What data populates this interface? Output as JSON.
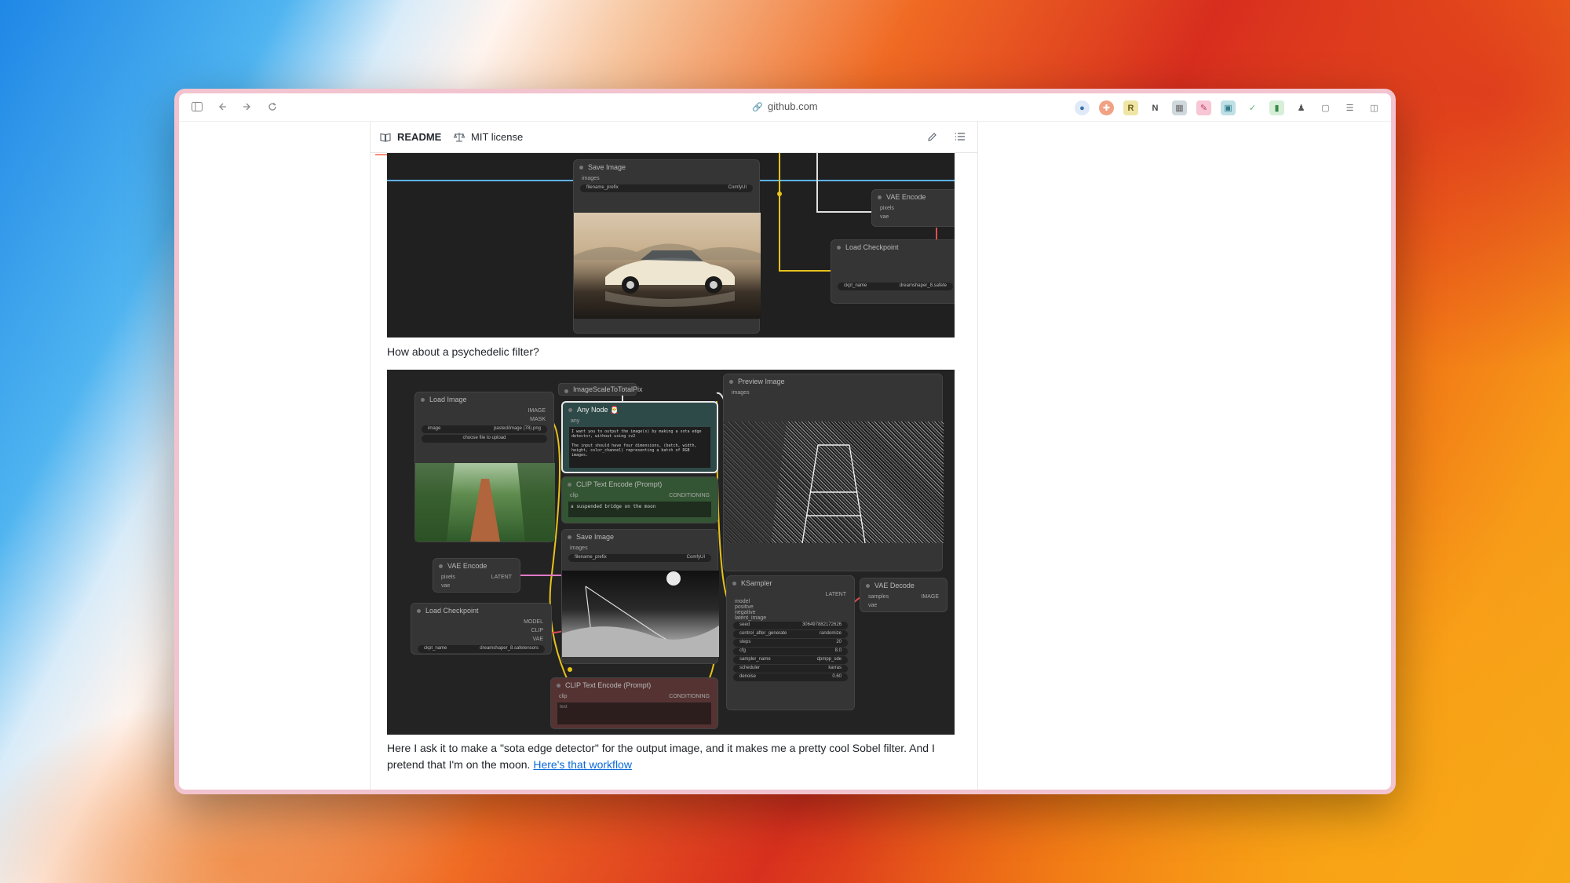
{
  "browser": {
    "url": "github.com",
    "icons": {
      "sidebar": "sidebar-icon",
      "back": "back-icon",
      "forward": "forward-icon",
      "reload": "reload-icon",
      "lock": "lock-icon"
    },
    "extensions": [
      "extension-1",
      "extension-2",
      "extension-3",
      "extension-4",
      "extension-5",
      "extension-6",
      "extension-7",
      "extension-8",
      "extension-9",
      "extension-10",
      "extension-11",
      "extension-12",
      "extension-13"
    ]
  },
  "tabs": {
    "readme": "README",
    "license": "MIT license"
  },
  "screenshot1": {
    "save_image_title": "Save Image",
    "images_label": "images",
    "filename_prefix_label": "filename_prefix",
    "filename_prefix_value": "ComfyUI",
    "vae_encode_title": "VAE Encode",
    "pixels_label": "pixels",
    "vae_label": "vae",
    "load_checkpoint_title": "Load Checkpoint",
    "ckpt_name_label": "ckpt_name",
    "ckpt_name_value": "dreamshaper_8.safete"
  },
  "caption1": "How about a psychedelic filter?",
  "screenshot2": {
    "load_image_title": "Load Image",
    "image_out": "IMAGE",
    "mask_out": "MASK",
    "image_label": "image",
    "image_value": "pasted/image (78).png",
    "upload_label": "choose file to upload",
    "scale_title": "ImageScaleToTotalPix",
    "any_node_title": "Any Node 🎅",
    "any_label": "any",
    "any_prompt": "I want you to output the image(s) by making a sota edge detector, without using cv2\n\nThe input should have four dimensions, (batch, width, height, color_channel) representing a batch of RGB images.",
    "clip1_title": "CLIP Text Encode (Prompt)",
    "clip_label": "clip",
    "conditioning_out": "CONDITIONING",
    "clip1_text": "a suspended bridge on the moon",
    "save_title": "Save Image",
    "images_label": "images",
    "filename_prefix_label": "filename_prefix",
    "filename_prefix_value": "ComfyUI",
    "vae_encode_title": "VAE Encode",
    "pixels_label": "pixels",
    "vae_label": "vae",
    "latent_out": "LATENT",
    "load_ckpt_title": "Load Checkpoint",
    "model_out": "MODEL",
    "clip_out": "CLIP",
    "vae_out": "VAE",
    "ckpt_label": "ckpt_name",
    "ckpt_value": "dreamshaper_8.safetensors",
    "clip2_title": "CLIP Text Encode (Prompt)",
    "clip2_text": "text",
    "preview_title": "Preview Image",
    "ksampler_title": "KSampler",
    "ks_inputs": [
      "model",
      "positive",
      "negative",
      "latent_image"
    ],
    "ks_fields": [
      {
        "label": "seed",
        "value": "306497882172626"
      },
      {
        "label": "control_after_generate",
        "value": "randomize"
      },
      {
        "label": "steps",
        "value": "20"
      },
      {
        "label": "cfg",
        "value": "8.0"
      },
      {
        "label": "sampler_name",
        "value": "dpmpp_sde"
      },
      {
        "label": "scheduler",
        "value": "karras"
      },
      {
        "label": "denoise",
        "value": "0.60"
      }
    ],
    "vae_decode_title": "VAE Decode",
    "samples_label": "samples",
    "image_out2": "IMAGE"
  },
  "caption2": {
    "text": "Here I ask it to make a \"sota edge detector\" for the output image, and it makes me a pretty cool Sobel filter. And I pretend that I'm on the moon. ",
    "link": "Here's that workflow"
  },
  "colors": {
    "accent_tab": "#fd8c73",
    "link": "#0969da",
    "wire_yellow": "#e8c21a",
    "wire_blue": "#5fb2ee"
  }
}
